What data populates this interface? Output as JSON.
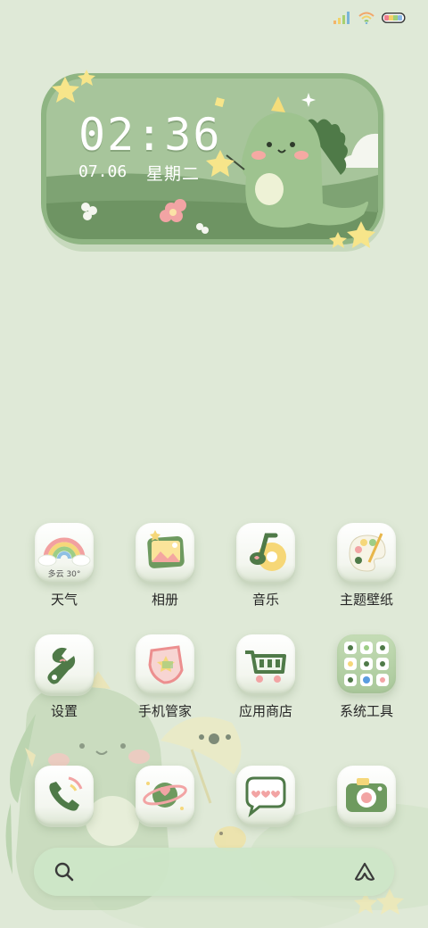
{
  "status_bar": {
    "signal_icon": "signal-bars-icon",
    "wifi_icon": "wifi-icon",
    "battery_icon": "battery-icon"
  },
  "clock_widget": {
    "time": "02:36",
    "date": "07.06",
    "weekday": "星期二"
  },
  "apps_row1": [
    {
      "label": "天气",
      "icon": "rainbow-weather-icon",
      "sub": "多云 30°"
    },
    {
      "label": "相册",
      "icon": "photo-album-icon"
    },
    {
      "label": "音乐",
      "icon": "music-note-icon"
    },
    {
      "label": "主题壁纸",
      "icon": "paint-palette-icon"
    }
  ],
  "apps_row2": [
    {
      "label": "设置",
      "icon": "wrench-icon"
    },
    {
      "label": "手机管家",
      "icon": "shield-star-icon"
    },
    {
      "label": "应用商店",
      "icon": "shopping-cart-icon"
    },
    {
      "label": "系统工具",
      "icon": "tools-folder-icon"
    }
  ],
  "dock": [
    {
      "icon": "phone-icon"
    },
    {
      "icon": "browser-planet-icon"
    },
    {
      "icon": "message-bubble-icon"
    },
    {
      "icon": "camera-icon"
    }
  ],
  "search_bar": {
    "search_icon": "search-icon",
    "assistant_icon": "assistant-icon"
  },
  "colors": {
    "background": "#dfe9d7",
    "accent_green": "#7fa874",
    "dark_green": "#4f7a48"
  }
}
